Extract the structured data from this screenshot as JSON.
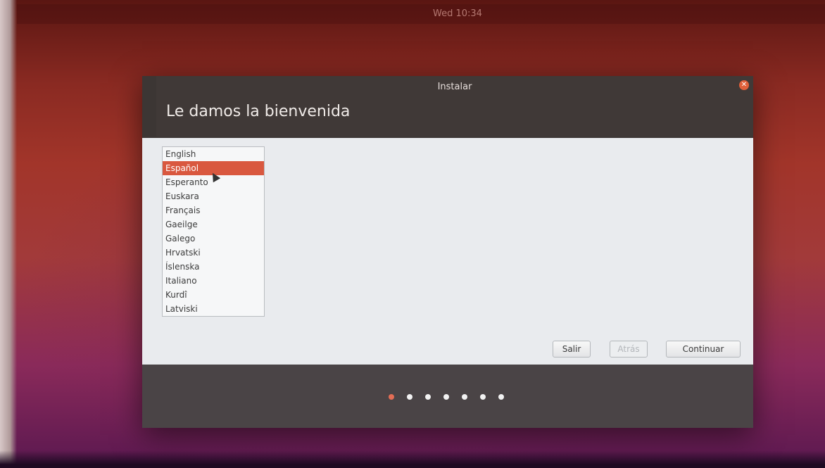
{
  "system": {
    "clock": "Wed 10:34"
  },
  "window": {
    "title": "Instalar",
    "heading": "Le damos la bienvenida"
  },
  "languages": {
    "items": [
      "English",
      "Español",
      "Esperanto",
      "Euskara",
      "Français",
      "Gaeilge",
      "Galego",
      "Hrvatski",
      "Íslenska",
      "Italiano",
      "Kurdî",
      "Latviski"
    ],
    "selected": "Español"
  },
  "buttons": {
    "quit": "Salir",
    "back": "Atrás",
    "continue": "Continuar"
  },
  "progress": {
    "total_steps": 7,
    "current_step": 1
  },
  "colors": {
    "accent": "#d9583f",
    "progress_active": "#e36d55"
  },
  "icons": {
    "close": "close-icon",
    "pointer": "mouse-pointer-icon"
  }
}
